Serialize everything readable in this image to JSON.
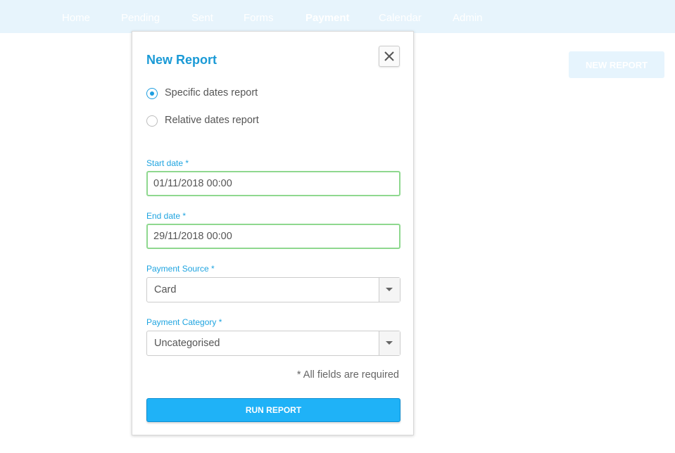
{
  "nav": {
    "items": [
      {
        "label": "Home",
        "active": false
      },
      {
        "label": "Pending",
        "active": false
      },
      {
        "label": "Sent",
        "active": false
      },
      {
        "label": "Forms",
        "active": false
      },
      {
        "label": "Payment",
        "active": true
      },
      {
        "label": "Calendar",
        "active": false
      },
      {
        "label": "Admin",
        "active": false
      }
    ]
  },
  "page": {
    "new_report_button": "NEW REPORT"
  },
  "modal": {
    "title": "New Report",
    "close_icon": "close-icon",
    "report_types": [
      {
        "label": "Specific dates report",
        "checked": true
      },
      {
        "label": "Relative dates report",
        "checked": false
      }
    ],
    "start_date": {
      "label": "Start date *",
      "value": "01/11/2018 00:00"
    },
    "end_date": {
      "label": "End date *",
      "value": "29/11/2018 00:00"
    },
    "payment_source": {
      "label": "Payment Source *",
      "value": "Card"
    },
    "payment_category": {
      "label": "Payment Category *",
      "value": "Uncategorised"
    },
    "required_note": "* All fields are required",
    "run_button": "RUN REPORT"
  },
  "colors": {
    "accent": "#1fb2f7",
    "title": "#1a9ad6",
    "valid_border": "#8fd88f",
    "topbar": "#e7f4fc"
  }
}
